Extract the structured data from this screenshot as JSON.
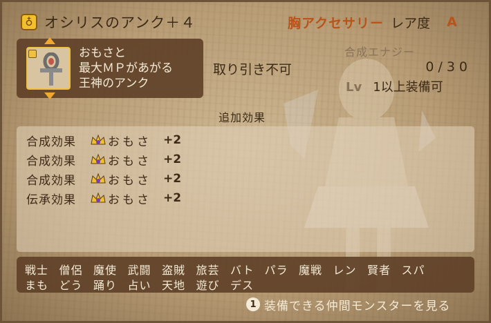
{
  "item": {
    "icon": "ring-icon",
    "name": "オシリスのアンク＋４",
    "category": "胸アクセサリー",
    "rarity_label": "レア度",
    "rarity": "A",
    "description": [
      "おもさと",
      "最大ＭＰがあがる",
      "王神のアンク"
    ]
  },
  "trade": "取り引き不可",
  "synthesis": {
    "label": "合成エナジー",
    "current": "0/",
    "max": "30"
  },
  "level": {
    "label": "Lv",
    "text": "1以上装備可"
  },
  "effects": {
    "header": "追加効果",
    "rows": [
      {
        "type": "合成効果",
        "stat": "おもさ",
        "value": "+2"
      },
      {
        "type": "合成効果",
        "stat": "おもさ",
        "value": "+2"
      },
      {
        "type": "合成効果",
        "stat": "おもさ",
        "value": "+2"
      },
      {
        "type": "伝承効果",
        "stat": "おもさ",
        "value": "+2"
      }
    ]
  },
  "jobs": {
    "row1": [
      "戦士",
      "僧侶",
      "魔使",
      "武闘",
      "盗賊",
      "旅芸",
      "バト",
      "パラ",
      "魔戦",
      "レン",
      "賢者",
      "スパ"
    ],
    "row2": [
      "まも",
      "どう",
      "踊り",
      "占い",
      "天地",
      "遊び",
      "デス"
    ]
  },
  "monster_button": {
    "key": "1",
    "label": "装備できる仲間モンスターを見る"
  },
  "colors": {
    "accent": "#b8541a",
    "panel": "#5f4128",
    "parchment": "#c8b08a"
  }
}
